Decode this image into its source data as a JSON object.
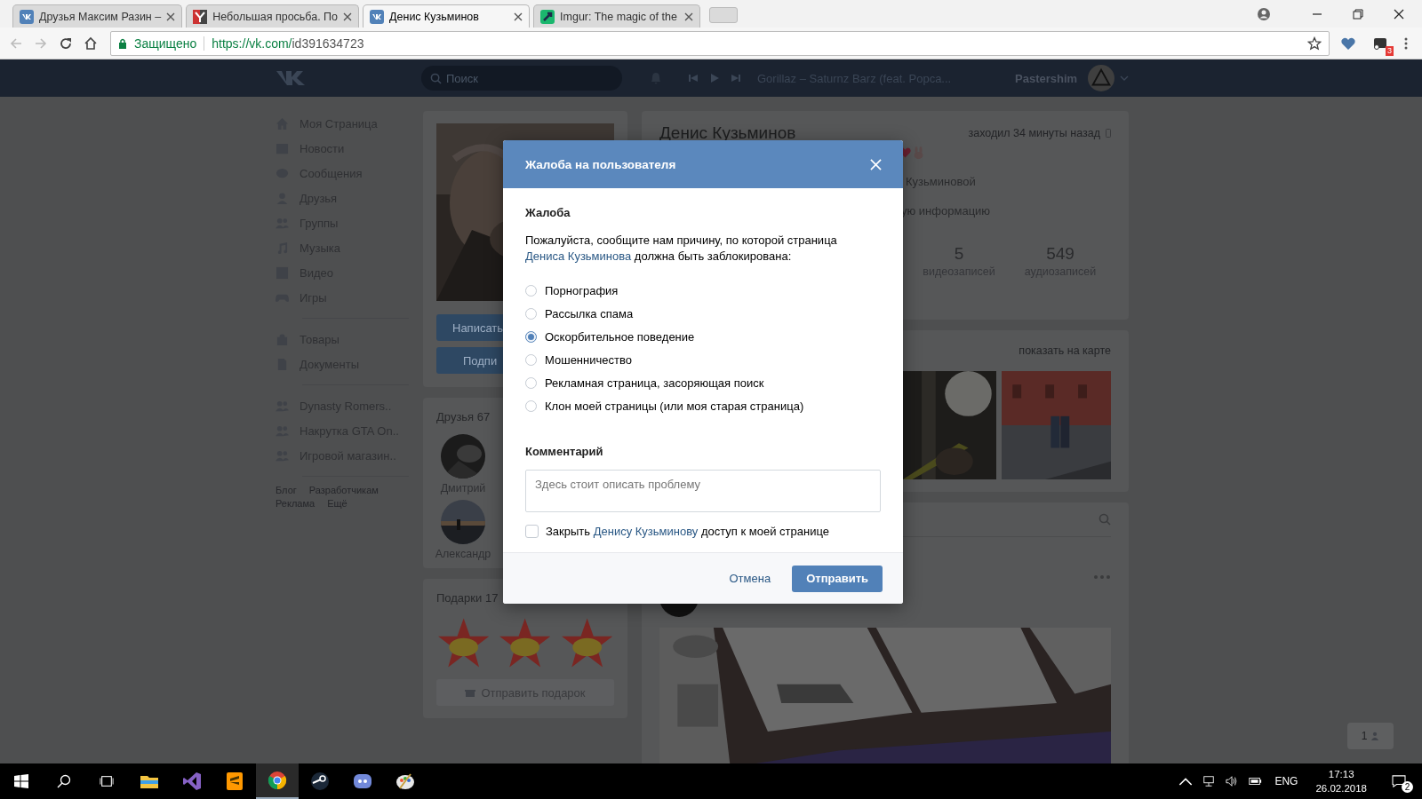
{
  "browser": {
    "tabs": [
      {
        "title": "Друзья Максим Разин –",
        "kind": "vk",
        "selected": false
      },
      {
        "title": "Небольшая просьба. По",
        "kind": "letter",
        "selected": false
      },
      {
        "title": "Денис Кузьминов",
        "kind": "vk",
        "selected": true
      },
      {
        "title": "Imgur: The magic of the",
        "kind": "imgur",
        "selected": false
      }
    ],
    "security": "Защищено",
    "url_host": "https://vk.com/",
    "url_path": "id391634723",
    "extension_badge": "3"
  },
  "header": {
    "search_placeholder": "Поиск",
    "track": "Gorillaz – Saturnz Barz (feat. Popca...",
    "user": "Pastershim"
  },
  "sidebar": {
    "sections": [
      [
        {
          "label": "Моя Страница",
          "kind": "home"
        },
        {
          "label": "Новости",
          "kind": "news"
        },
        {
          "label": "Сообщения",
          "kind": "messages"
        },
        {
          "label": "Друзья",
          "kind": "person"
        },
        {
          "label": "Группы",
          "kind": "people"
        },
        {
          "label": "Музыка",
          "kind": "music"
        },
        {
          "label": "Видео",
          "kind": "video"
        },
        {
          "label": "Игры",
          "kind": "gamepad"
        }
      ],
      [
        {
          "label": "Товары",
          "kind": "bag"
        },
        {
          "label": "Документы",
          "kind": "document"
        }
      ],
      [
        {
          "label": "Dynasty Romers..",
          "kind": "people"
        },
        {
          "label": "Накрутка GTA On..",
          "kind": "people"
        },
        {
          "label": "Игровой магазин..",
          "kind": "people"
        }
      ]
    ],
    "footer_links": [
      "Блог",
      "Разработчикам",
      "Реклама",
      "Ещё"
    ]
  },
  "profile_actions": [
    "Написать",
    "Подпи"
  ],
  "friends": {
    "title": "Друзья",
    "count": "67",
    "people": [
      {
        "name": "Дмитрий"
      },
      {
        "name": "Александр"
      }
    ]
  },
  "gifts": {
    "title": "Подарки",
    "count": "17",
    "items": [
      {
        "kind": "star"
      },
      {
        "kind": "star"
      },
      {
        "kind": "star"
      }
    ],
    "button": "Отправить подарок"
  },
  "profile": {
    "name": "Денис Кузьминов",
    "last_seen": "заходил 34 минуты назад",
    "info_lines": [
      "Кузьминовой",
      "ую информацию"
    ],
    "counters": [
      {
        "value": "5",
        "label": "видеозаписей"
      },
      {
        "value": "549",
        "label": "аудиозаписей"
      }
    ],
    "photos_link": "показать на карте"
  },
  "online_badge": "1",
  "complaint": {
    "title": "Жалоба на пользователя",
    "section": "Жалоба",
    "description": {
      "before": "Пожалуйста, сообщите нам причину, по которой страница",
      "link": "Дениса Кузьминова",
      "after": "должна быть заблокирована:"
    },
    "reasons": [
      {
        "label": "Порнография",
        "selected": false
      },
      {
        "label": "Рассылка спама",
        "selected": false
      },
      {
        "label": "Оскорбительное поведение",
        "selected": true
      },
      {
        "label": "Мошенничество",
        "selected": false
      },
      {
        "label": "Рекламная страница, засоряющая поиск",
        "selected": false
      },
      {
        "label": "Клон моей страницы (или моя старая страница)",
        "selected": false
      }
    ],
    "comment_title": "Комментарий",
    "comment_placeholder": "Здесь стоит описать проблему",
    "block": {
      "before": "Закрыть",
      "link": "Денису Кузьминову",
      "after": "доступ к моей странице",
      "checked": false
    },
    "cancel": "Отмена",
    "submit": "Отправить"
  },
  "taskbar": {
    "apps": [
      {
        "kind": "explorer",
        "selected": false
      },
      {
        "kind": "vs",
        "selected": false
      },
      {
        "kind": "sublime",
        "selected": false
      },
      {
        "kind": "chrome",
        "selected": true
      },
      {
        "kind": "steam",
        "selected": false
      },
      {
        "kind": "discord",
        "selected": false
      },
      {
        "kind": "paint",
        "selected": false
      }
    ],
    "language": "ENG",
    "time": "17:13",
    "date": "26.02.2018",
    "notifications": "2"
  }
}
